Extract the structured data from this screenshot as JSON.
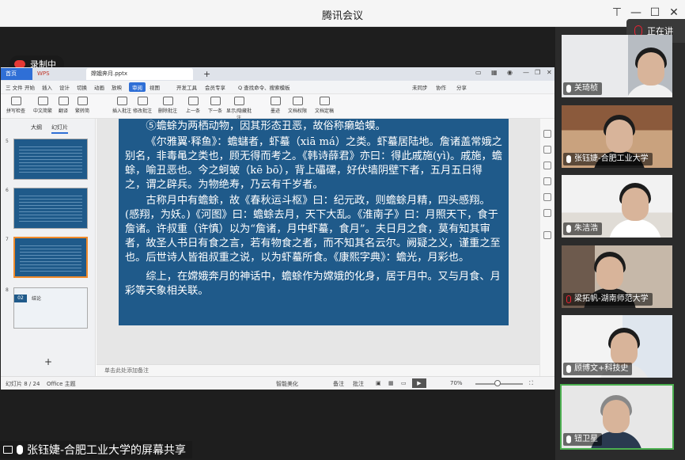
{
  "app": {
    "title": "腾讯会议",
    "recording_label": "录制中",
    "speaking_label": "正在讲",
    "share_label": "张钰婕-合肥工业大学的屏幕共享"
  },
  "wps": {
    "tabs": {
      "home": "首页",
      "wps": "WPS",
      "doc": "嫦娥奔月.pptx",
      "plus": "+"
    },
    "menu": [
      "三 文件",
      "开始",
      "插入",
      "设计",
      "切换",
      "动画",
      "放映",
      "审阅",
      "视图",
      "开发工具",
      "会员专享",
      "Q 查找命令、搜索模板",
      "未同步",
      "协作",
      "分享"
    ],
    "menu_active_index": 7,
    "toolbar": [
      "拼写检查",
      "中文简繁",
      "翻译",
      "繁转简",
      "插入批注",
      "修改批注",
      "删除批注",
      "上一条",
      "下一条",
      "显示/隐藏批注",
      "墨迹",
      "文档权限",
      "文档定稿"
    ],
    "left_tabs": [
      "大纲",
      "幻灯片"
    ],
    "thumbnails": [
      "",
      "",
      "",
      "02"
    ],
    "thumb_last_title": "结论",
    "notes_placeholder": "单击此处添加备注",
    "status": {
      "slide": "幻灯片 8 / 24",
      "theme": "Office 主题",
      "beautify": "智能美化",
      "notes": "备注",
      "comments": "批注",
      "zoom": "70%"
    },
    "slide_paragraphs": [
      "⑤蟾蜍为两栖动物，因其形态丑恶，故俗称癞蛤蟆。",
      "《尔雅翼·释鱼》：蟾蠩者，虾蟇（xiā má）之类。虾蟇居陆地。詹诸盖常娥之别名，非毒黾之类也，顾无得而考之。《韩诗薛君》亦曰：得此戚施(yì)。戚施，蟾蜍，喻丑恶也。今之蚵蚾（kē bō），背上礧磥，好伏墙阴壁下者，五月五日得之，谓之辟兵。为物绝寿，乃云有千岁者。",
      "古称月中有蟾蜍，故《春秋运斗枢》曰：纪元政，则蟾蜍月精，四头感翔。(感翔，为妖。)《河图》曰：蟾蜍去月，天下大乱。《淮南子》曰：月照天下，食于詹诸。许叔重（许慎）以为“詹诸，月中虾蟇，食月”。夫日月之食，莫有知其审者，故圣人书日有食之言，若有物食之者，而不知其名云尔。阙疑之义，谨重之至也。后世诗人皆祖叔重之说，以为虾蟇所食。《康熙字典》：蟾光，月彩也。",
      "综上，在嫦娥奔月的神话中，蟾蜍作为嫦娥的化身，居于月中。又与月食、月彩等天象相关联。"
    ]
  },
  "participants": [
    {
      "name": "关琦桢",
      "mic": "on"
    },
    {
      "name": "张钰婕-合肥工业大学",
      "mic": "on"
    },
    {
      "name": "朱洁浩",
      "mic": "on"
    },
    {
      "name": "梁拓帆-湖南师范大学",
      "mic": "off"
    },
    {
      "name": "顾博文+科技史",
      "mic": "on"
    },
    {
      "name": "钮卫星",
      "mic": "on"
    }
  ],
  "colors": {
    "slide_bg": "#1f5a8a",
    "accent": "#2f6fd6",
    "record": "#e53935",
    "active_speaker": "#4caf50"
  },
  "icons": [
    "cloud-record-icon",
    "minimize-icon",
    "maximize-icon",
    "close-icon",
    "mic-icon",
    "mic-off-icon",
    "screen-share-icon",
    "play-icon"
  ]
}
